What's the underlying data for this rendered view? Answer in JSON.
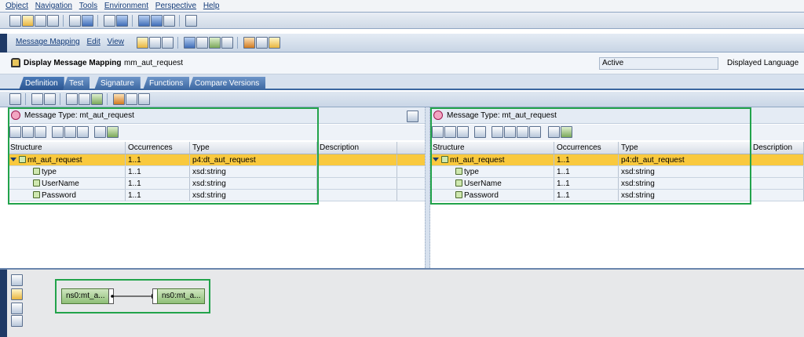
{
  "menu": [
    "Object",
    "Navigation",
    "Tools",
    "Environment",
    "Perspective",
    "Help"
  ],
  "sub_toolbar": {
    "message_mapping": "Message Mapping",
    "edit": "Edit",
    "view": "View"
  },
  "title": {
    "label": "Display Message Mapping",
    "name": "mm_aut_request",
    "status": "Active",
    "language": "Displayed Language"
  },
  "tabs": [
    "Definition",
    "Test",
    "Signature",
    "Functions",
    "Compare Versions"
  ],
  "left_pane": {
    "message_type": "Message Type: mt_aut_request",
    "columns": [
      "Structure",
      "Occurrences",
      "Type",
      "Description"
    ],
    "rows": [
      {
        "structure": "mt_aut_request",
        "occ": "1..1",
        "type": "p4:dt_aut_request",
        "desc": ""
      },
      {
        "structure": "type",
        "occ": "1..1",
        "type": "xsd:string",
        "desc": ""
      },
      {
        "structure": "UserName",
        "occ": "1..1",
        "type": "xsd:string",
        "desc": ""
      },
      {
        "structure": "Password",
        "occ": "1..1",
        "type": "xsd:string",
        "desc": ""
      }
    ]
  },
  "right_pane": {
    "message_type": "Message Type: mt_aut_request",
    "columns": [
      "Structure",
      "Occurrences",
      "Type",
      "Description"
    ],
    "rows": [
      {
        "structure": "mt_aut_request",
        "occ": "1..1",
        "type": "p4:dt_aut_request",
        "desc": ""
      },
      {
        "structure": "type",
        "occ": "1..1",
        "type": "xsd:string",
        "desc": ""
      },
      {
        "structure": "UserName",
        "occ": "1..1",
        "type": "xsd:string",
        "desc": ""
      },
      {
        "structure": "Password",
        "occ": "1..1",
        "type": "xsd:string",
        "desc": ""
      }
    ]
  },
  "mapping": {
    "source_node": "ns0:mt_a...",
    "target_node": "ns0:mt_a..."
  },
  "colors": {
    "selection": "#f9c93e",
    "highlight_box": "#22a34b",
    "tab": "#3a66a0"
  }
}
